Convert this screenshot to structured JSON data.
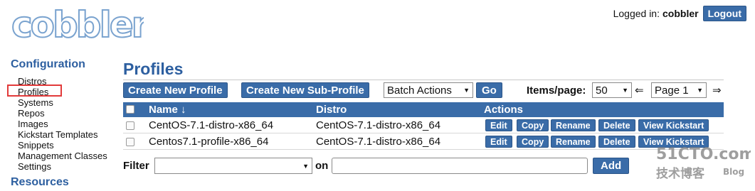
{
  "brand": {
    "logo_text": "cobbler"
  },
  "login": {
    "prefix": "Logged in:",
    "user": "cobbler",
    "logout_label": "Logout"
  },
  "sidebar": {
    "configuration_heading": "Configuration",
    "items": [
      {
        "label": "Distros"
      },
      {
        "label": "Profiles"
      },
      {
        "label": "Systems"
      },
      {
        "label": "Repos"
      },
      {
        "label": "Images"
      },
      {
        "label": "Kickstart Templates"
      },
      {
        "label": "Snippets"
      },
      {
        "label": "Management Classes"
      },
      {
        "label": "Settings"
      }
    ],
    "resources_heading": "Resources"
  },
  "main": {
    "title": "Profiles",
    "toolbar": {
      "create_profile": "Create New Profile",
      "create_subprofile": "Create New Sub-Profile",
      "batch_actions": "Batch Actions",
      "go": "Go",
      "items_per_page_label": "Items/page:",
      "items_per_page_value": "50",
      "prev_arrow": "⇐",
      "page_value": "Page 1",
      "next_arrow": "⇒"
    },
    "table": {
      "columns": {
        "name": "Name ↓",
        "distro": "Distro",
        "actions": "Actions"
      },
      "rows": [
        {
          "name": "CentOS-7.1-distro-x86_64",
          "distro": "CentOS-7.1-distro-x86_64"
        },
        {
          "name": "Centos7.1-profile-x86_64",
          "distro": "CentOS-7.1-distro-x86_64"
        }
      ],
      "row_actions": {
        "edit": "Edit",
        "copy": "Copy",
        "rename": "Rename",
        "delete": "Delete",
        "view": "View Kickstart"
      }
    },
    "filter": {
      "label": "Filter",
      "on_label": "on",
      "add_label": "Add"
    }
  },
  "watermark": {
    "text1": "51CTO.com",
    "text2": "技术博客",
    "text3": "Blog"
  },
  "colors": {
    "accent": "#3a6ca8",
    "heading": "#2d5fa0",
    "highlight": "#e23a3a"
  }
}
